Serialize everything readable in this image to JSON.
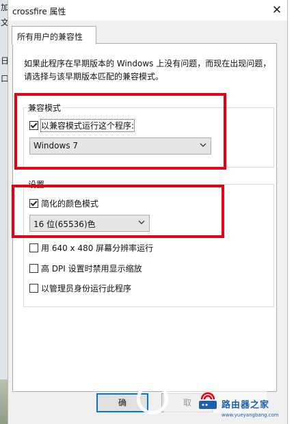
{
  "background_edge": {
    "chars": [
      "加",
      "文",
      "日",
      "口"
    ]
  },
  "window": {
    "title": "crossfire 属性",
    "close_icon": "close-icon"
  },
  "tab": {
    "label": "所有用户的兼容性"
  },
  "description": {
    "line1": "如果此程序在早期版本的 Windows 上没有问题，而现在出现问题，",
    "line2": "请选择与该早期版本匹配的兼容模式。"
  },
  "compat_mode": {
    "group_label": "兼容模式",
    "checkbox_label": "以兼容模式运行这个程序:",
    "checked": true,
    "select_value": "Windows 7"
  },
  "settings": {
    "group_label": "设置",
    "reduced_color": {
      "label": "简化的颜色模式",
      "checked": true,
      "select_value": "16 位(65536)色"
    },
    "res_640": {
      "label": "用 640 x 480 屏幕分辨率运行",
      "checked": false
    },
    "high_dpi": {
      "label": "高 DPI 设置时禁用显示缩放",
      "checked": false
    },
    "run_admin": {
      "label": "以管理员身份运行此程序",
      "checked": false
    }
  },
  "buttons": {
    "ok_label": "确",
    "cancel_label": "取"
  },
  "watermark": {
    "name": "路由器之家",
    "url": "www.yueyangbang.com"
  },
  "colors": {
    "highlight": "#e60012",
    "accent": "#0078d7"
  }
}
